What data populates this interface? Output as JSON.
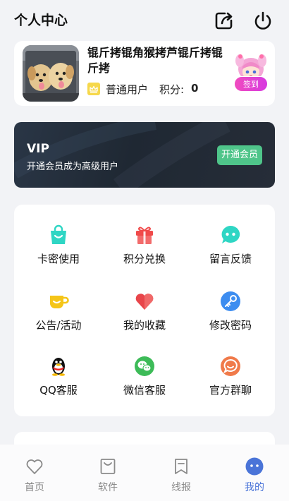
{
  "header": {
    "title": "个人中心",
    "share_icon": "share-icon",
    "power_icon": "power-icon"
  },
  "profile": {
    "nickname": "锟斤拷锟角猴拷芦锟斤拷锟斤拷",
    "level_icon": "crown-icon",
    "level": "普通用户",
    "points_label": "积分:",
    "points_value": "0",
    "signin_label": "签到",
    "signin_mascot": "anime-girl-mascot"
  },
  "vip": {
    "title": "VIP",
    "subtitle": "开通会员成为高级用户",
    "button": "开通会员"
  },
  "menu": {
    "items": [
      {
        "label": "卡密使用",
        "icon": "shopping-bag-icon",
        "color": "#2fd6c4"
      },
      {
        "label": "积分兑换",
        "icon": "gift-icon",
        "color": "#f04a4a"
      },
      {
        "label": "留言反馈",
        "icon": "chat-bubble-icon",
        "color": "#2fd6c4"
      },
      {
        "label": "公告/活动",
        "icon": "cup-icon",
        "color": "#f5c518"
      },
      {
        "label": "我的收藏",
        "icon": "heart-icon",
        "color": "#e8454a"
      },
      {
        "label": "修改密码",
        "icon": "key-icon",
        "color": "#3d8df0"
      },
      {
        "label": "QQ客服",
        "icon": "qq-penguin-icon",
        "color": "#111111"
      },
      {
        "label": "微信客服",
        "icon": "wechat-icon",
        "color": "#3dbb58"
      },
      {
        "label": "官方群聊",
        "icon": "group-chat-icon",
        "color": "#f07a4a"
      }
    ]
  },
  "tabbar": {
    "tabs": [
      {
        "label": "首页",
        "icon": "heart-outline-icon",
        "active": false
      },
      {
        "label": "软件",
        "icon": "bag-outline-icon",
        "active": false
      },
      {
        "label": "线报",
        "icon": "bookmark-outline-icon",
        "active": false
      },
      {
        "label": "我的",
        "icon": "face-icon",
        "active": true
      }
    ]
  },
  "colors": {
    "accent": "#4a74d8",
    "vip_button": "#4fc58a",
    "signin_gradient": "#f04bbf"
  }
}
